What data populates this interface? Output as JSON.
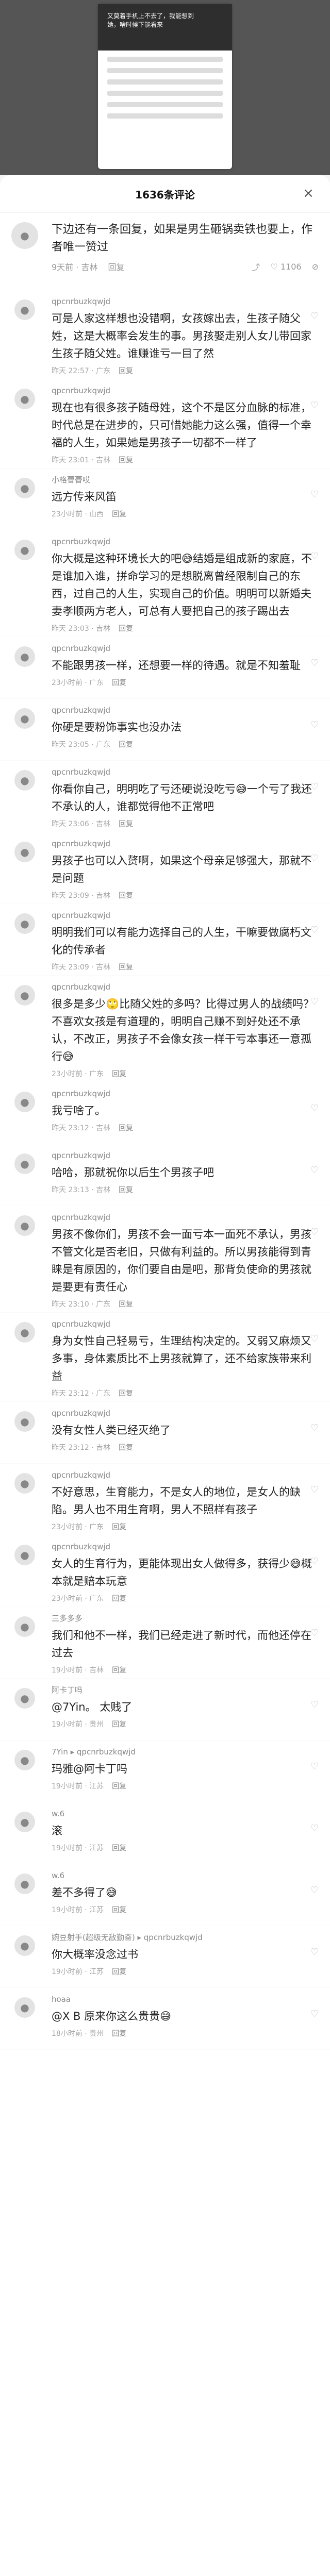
{
  "header": {
    "title": "1636条评论",
    "close_icon": "close-icon"
  },
  "top_card": {
    "line1": "又莫着手机上不去了，我能想到",
    "line2": "她，啥时候下能看来"
  },
  "first_comment": {
    "text": "下边还有一条回复，如果是男生砸锅卖铁也要上，作者唯一赞过",
    "time": "9天前 · 吉林",
    "reply_label": "回复",
    "like_count": "1106"
  },
  "comments": [
    {
      "user": "qpcnrbuzkqwjd",
      "text": "可是人家这样想也没错啊，女孩嫁出去，生孩子随父姓，这是大概率会发生的事。男孩娶走别人女儿带回家生孩子随父姓。谁赚谁亏一目了然",
      "time": "昨天 22:57 · 广东",
      "reply": "回复"
    },
    {
      "user": "qpcnrbuzkqwjd",
      "text": "现在也有很多孩子随母姓，这个不是区分血脉的标准，时代总是在进步的，只可惜她能力这么强，值得一个幸福的人生，如果她是男孩子一切都不一样了",
      "time": "昨天 23:01 · 吉林",
      "reply": "回复"
    },
    {
      "user": "小格瞢瞢哎",
      "text": "远方传来风笛",
      "time": "23小时前 · 山西",
      "reply": "回复"
    },
    {
      "user": "qpcnrbuzkqwjd",
      "text": "你大概是这种环境长大的吧😅结婚是组成新的家庭，不是谁加入谁，拼命学习的是想脱离曾经限制自己的东西，过自己的人生，实现自己的价值。明明可以新婚夫妻孝顺两方老人，可总有人要把自己的孩子踢出去",
      "time": "昨天 23:03 · 吉林",
      "reply": "回复"
    },
    {
      "user": "qpcnrbuzkqwjd",
      "text": "不能跟男孩一样，还想要一样的待遇。就是不知羞耻",
      "time": "23小时前 · 广东",
      "reply": "回复"
    },
    {
      "user": "qpcnrbuzkqwjd",
      "text": "你硬是要粉饰事实也没办法",
      "time": "昨天 23:05 · 广东",
      "reply": "回复"
    },
    {
      "user": "qpcnrbuzkqwjd",
      "text": "你看你自己，明明吃了亏还硬说没吃亏😅一个亏了我还不承认的人，谁都觉得他不正常吧",
      "time": "昨天 23:06 · 吉林",
      "reply": "回复"
    },
    {
      "user": "qpcnrbuzkqwjd",
      "text": "男孩子也可以入赘啊，如果这个母亲足够强大，那就不是问题",
      "time": "昨天 23:09 · 吉林",
      "reply": "回复"
    },
    {
      "user": "qpcnrbuzkqwjd",
      "text": "明明我们可以有能力选择自己的人生，干嘛要做腐朽文化的传承者",
      "time": "昨天 23:09 · 吉林",
      "reply": "回复"
    },
    {
      "user": "qpcnrbuzkqwjd",
      "text": "很多是多少🙄比随父姓的多吗？比得过男人的战绩吗？不喜欢女孩是有道理的，明明自己赚不到好处还不承认，不改正，男孩子不会像女孩一样干亏本事还一意孤行😅",
      "time": "23小时前 · 广东",
      "reply": "回复"
    },
    {
      "user": "qpcnrbuzkqwjd",
      "text": "我亏啥了。",
      "time": "昨天 23:12 · 吉林",
      "reply": "回复"
    },
    {
      "user": "qpcnrbuzkqwjd",
      "text": "哈哈，那就祝你以后生个男孩子吧",
      "time": "昨天 23:13 · 吉林",
      "reply": "回复"
    },
    {
      "user": "qpcnrbuzkqwjd",
      "text": "男孩不像你们，男孩不会一面亏本一面死不承认，男孩不管文化是否老旧，只做有利益的。所以男孩能得到青睐是有原因的，你们要自由是吧，那背负使命的男孩就是要更有责任心",
      "time": "昨天 23:10 · 广东",
      "reply": "回复"
    },
    {
      "user": "qpcnrbuzkqwjd",
      "text": "身为女性自己轻易亏，生理结构决定的。又弱又麻烦又多事，身体素质比不上男孩就算了，还不给家族带来利益",
      "time": "昨天 23:12 · 广东",
      "reply": "回复"
    },
    {
      "user": "qpcnrbuzkqwjd",
      "text": "没有女性人类已经灭绝了",
      "time": "昨天 23:12 · 吉林",
      "reply": "回复"
    },
    {
      "user": "qpcnrbuzkqwjd",
      "text": "不好意思，生育能力，不是女人的地位，是女人的缺陷。男人也不用生育啊，男人不照样有孩子",
      "time": "23小时前 · 广东",
      "reply": "回复"
    },
    {
      "user": "qpcnrbuzkqwjd",
      "text": "女人的生育行为，更能体现出女人做得多，获得少😅概本就是赔本玩意",
      "time": "23小时前 · 广东",
      "reply": "回复"
    },
    {
      "user": "三多多多",
      "text": "我们和他不一样，我们已经走进了新时代，而他还停在过去",
      "time": "19小时前 · 吉林",
      "reply": "回复"
    },
    {
      "user": "阿卡丁吗",
      "text": "@7Yin。 太贱了",
      "time": "19小时前 · 贵州",
      "reply": "回复"
    },
    {
      "user": "7Yin ▸ qpcnrbuzkqwjd",
      "text": "玛雅@阿卡丁吗",
      "time": "19小时前 · 江苏",
      "reply": "回复"
    },
    {
      "user": "w.6",
      "text": "滚",
      "time": "19小时前 · 江苏",
      "reply": "回复"
    },
    {
      "user": "w.6",
      "text": "差不多得了😅",
      "time": "19小时前 · 江苏",
      "reply": "回复"
    },
    {
      "user": "婉豆射手(超级无敌勤奋) ▸ qpcnrbuzkqwjd",
      "text": "你大概率没念过书",
      "time": "19小时前 · 江苏",
      "reply": "回复"
    },
    {
      "user": "hoaa",
      "text": "@X B 原来你这么贵贵😅",
      "time": "18小时前 · 贵州",
      "reply": "回复"
    }
  ]
}
